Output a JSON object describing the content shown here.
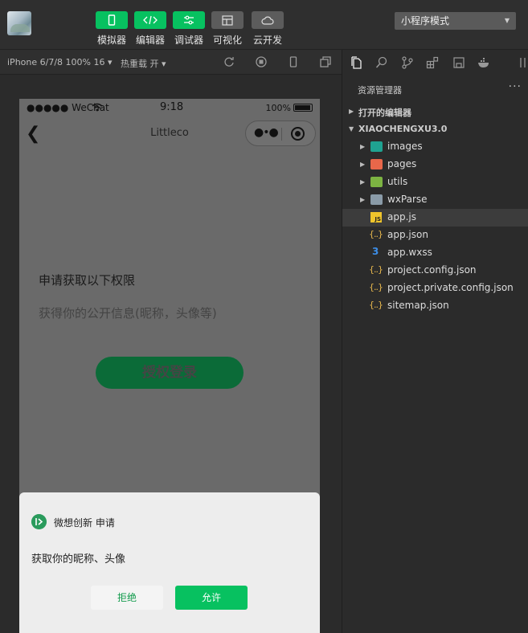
{
  "toolbar": {
    "buttons": [
      {
        "label": "模拟器",
        "icon": "phone-icon"
      },
      {
        "label": "编辑器",
        "icon": "code-icon"
      },
      {
        "label": "调试器",
        "icon": "sliders-icon"
      },
      {
        "label": "可视化",
        "icon": "layout-icon"
      },
      {
        "label": "云开发",
        "icon": "cloud-icon"
      }
    ],
    "mode": "小程序模式"
  },
  "subbar": {
    "device": "iPhone 6/7/8 100% 16",
    "hot_reload": "热重载 开"
  },
  "phone": {
    "status": {
      "carrier": "●●●●● WeChat",
      "time": "9:18",
      "battery": "100%"
    },
    "nav_title": "Littleco",
    "perm_title": "申请获取以下权限",
    "perm_desc": "获得你的公开信息(昵称，头像等)",
    "login_button": "授权登录",
    "sheet": {
      "app_name": "微想创新 申请",
      "scope": "获取你的昵称、头像",
      "reject": "拒绝",
      "allow": "允许"
    }
  },
  "explorer": {
    "title": "资源管理器",
    "more": "···",
    "open_editors": "打开的编辑器",
    "project": "XIAOCHENGXU3.0",
    "folders": [
      "images",
      "pages",
      "utils",
      "wxParse"
    ],
    "files": [
      "app.js",
      "app.json",
      "app.wxss",
      "project.config.json",
      "project.private.config.json",
      "sitemap.json"
    ]
  },
  "colors": {
    "accent": "#07c160",
    "bg": "#2b2b2b"
  }
}
